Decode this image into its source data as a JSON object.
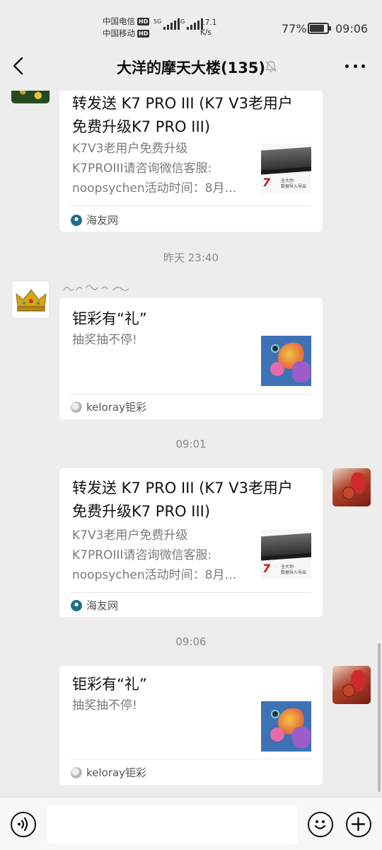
{
  "status_bar": {
    "carrier1": "中国电信",
    "carrier2": "中国移动",
    "hd": "HD",
    "net1": "5G",
    "net2": "4G",
    "speed_value": "17.1",
    "speed_unit": "K/s",
    "battery_pct": "77%",
    "battery_level": 0.77,
    "time": "09:06"
  },
  "header": {
    "title": "大洋的摩天大楼(135)",
    "back_icon": "chevron-left-icon",
    "mute_icon": "bell-off-icon",
    "more_icon": "more-dots-icon"
  },
  "messages": [
    {
      "side": "left",
      "title": "转发送 K7 PRO III (K7 V3老用户\n免费升级K7 PRO III)",
      "title_line1": "转发送 K7 PRO III (K7 V3老用户",
      "title_line2": "免费升级K7 PRO III)",
      "desc_line1": "K7V3老用户免费升级",
      "desc_line2": "K7PROIII请咨询微信客服:",
      "desc_line3": "noopsychen活动时间：8月…",
      "source": "海友网"
    },
    {
      "timestamp": "昨天 23:40"
    },
    {
      "side": "left",
      "title": "钜彩有“礼”",
      "desc": "抽奖抽不停!",
      "source": "keloray钜彩"
    },
    {
      "timestamp": "09:01"
    },
    {
      "side": "right",
      "title_line1": "转发送 K7 PRO III (K7 V3老用户",
      "title_line2": "免费升级K7 PRO III)",
      "desc_line1": "K7V3老用户免费升级",
      "desc_line2": "K7PROIII请咨询微信客服:",
      "desc_line3": "noopsychen活动时间：8月…",
      "source": "海友网"
    },
    {
      "timestamp": "09:06"
    },
    {
      "side": "right",
      "title": "钜彩有“礼”",
      "desc": "抽奖抽不停!",
      "source": "keloray钜彩"
    }
  ],
  "thumb_text": {
    "seven": "7",
    "line1": "全大师·",
    "line2": "数据导入导出"
  },
  "input_bar": {
    "voice_icon": "voice-icon",
    "emoji_icon": "emoji-icon",
    "plus_icon": "plus-icon",
    "input_value": ""
  },
  "colors": {
    "background": "#ededed",
    "card": "#ffffff",
    "timestamp": "#8a8a8a",
    "desc": "#7b7b7b"
  }
}
